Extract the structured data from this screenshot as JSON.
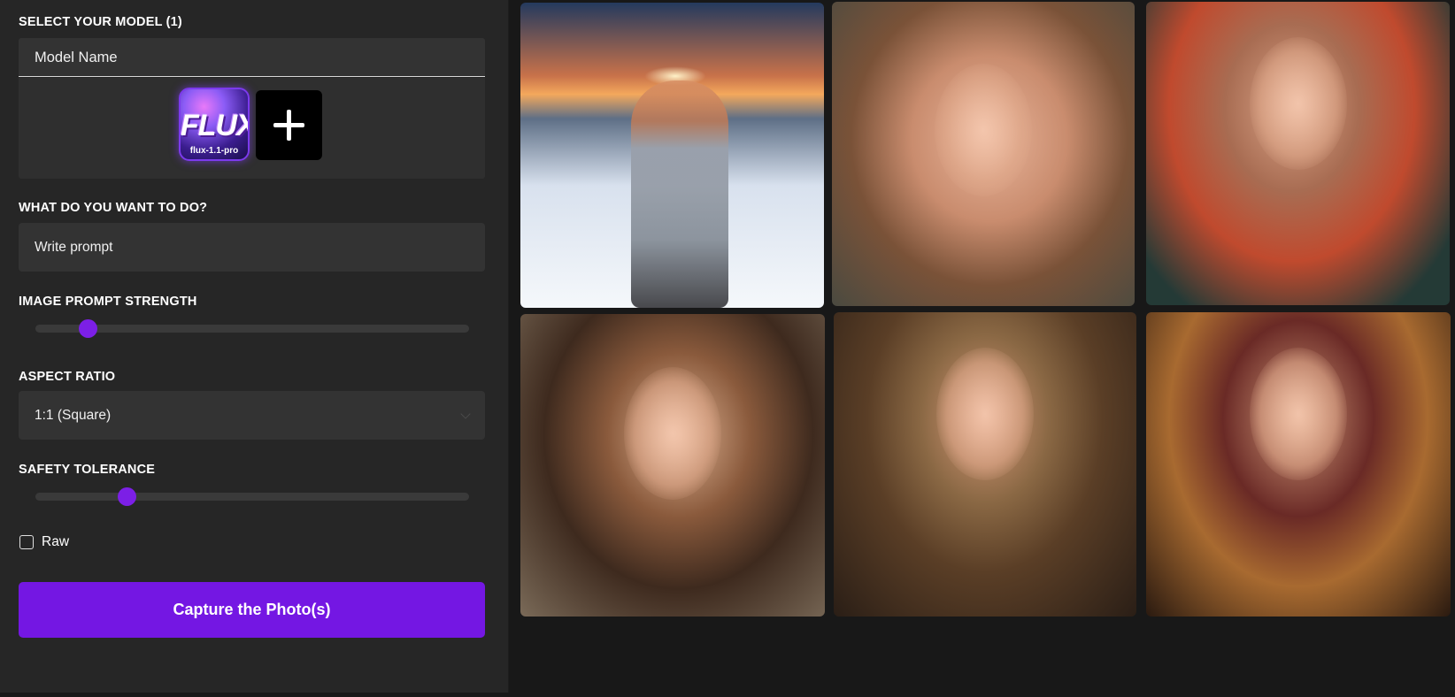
{
  "sidebar": {
    "model_section_label": "SELECT YOUR MODEL (1)",
    "model_name_placeholder": "Model Name",
    "models": [
      {
        "logo_text": "FLUX",
        "name": "flux-1.1-pro",
        "selected": true
      }
    ],
    "add_model_icon": "plus-icon",
    "task_label": "WHAT DO YOU WANT TO DO?",
    "prompt_placeholder": "Write prompt",
    "image_prompt_strength_label": "IMAGE PROMPT STRENGTH",
    "image_prompt_strength_value": 0.12,
    "aspect_ratio_label": "ASPECT RATIO",
    "aspect_ratio_value": "1:1 (Square)",
    "safety_tolerance_label": "SAFETY TOLERANCE",
    "safety_tolerance_value": 0.21,
    "raw_label": "Raw",
    "raw_checked": false,
    "capture_button": "Capture the Photo(s)"
  },
  "gallery": {
    "images": [
      {
        "subject": "woman-hiker-on-snowy-mountain-at-sunset"
      },
      {
        "subject": "woman-close-up-portrait"
      },
      {
        "subject": "older-woman-with-red-scarf-and-beret"
      },
      {
        "subject": "woman-with-dark-wavy-hair"
      },
      {
        "subject": "bearded-man-in-tweed-coat"
      },
      {
        "subject": "man-in-burgundy-suit-at-bar"
      }
    ]
  },
  "colors": {
    "accent": "#7417e3",
    "panel_bg": "#262626",
    "page_bg": "#181818",
    "field_bg": "#333333"
  }
}
